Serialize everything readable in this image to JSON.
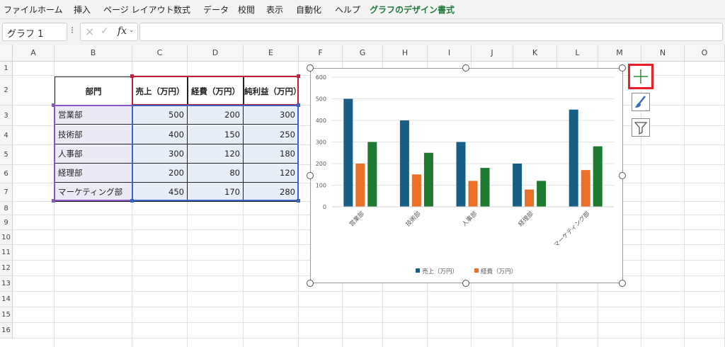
{
  "menu": [
    "ファイル",
    "ホーム",
    "挿入",
    "ページ レイアウト",
    "数式",
    "データ",
    "校閲",
    "表示",
    "自動化",
    "ヘルプ",
    "グラフのデザイン",
    "書式"
  ],
  "formula_bar": {
    "name_box": "グラフ 1",
    "fx": "fx",
    "value": ""
  },
  "columns": [
    "A",
    "B",
    "C",
    "D",
    "E",
    "F",
    "G",
    "H",
    "I",
    "J",
    "K",
    "L",
    "M",
    "N",
    "O"
  ],
  "rows": [
    "1",
    "2",
    "3",
    "4",
    "5",
    "6",
    "7",
    "8",
    "9",
    "10",
    "11",
    "12",
    "13",
    "14",
    "15",
    "16"
  ],
  "table": {
    "headers": [
      "部門",
      "売上（万円）",
      "経費（万円）",
      "純利益（万円）"
    ],
    "rows": [
      [
        "営業部",
        "500",
        "200",
        "300"
      ],
      [
        "技術部",
        "400",
        "150",
        "250"
      ],
      [
        "人事部",
        "300",
        "120",
        "180"
      ],
      [
        "経理部",
        "200",
        "80",
        "120"
      ],
      [
        "マーケティング部",
        "450",
        "170",
        "280"
      ]
    ]
  },
  "chart_data": {
    "type": "bar",
    "categories": [
      "営業部",
      "技術部",
      "人事部",
      "経理部",
      "マーケティング部"
    ],
    "series": [
      {
        "name": "売上（万円）",
        "values": [
          500,
          400,
          300,
          200,
          450
        ],
        "color": "#175f84"
      },
      {
        "name": "経費（万円）",
        "values": [
          200,
          150,
          120,
          80,
          170
        ],
        "color": "#e8702a"
      },
      {
        "name": "",
        "values": [
          300,
          250,
          180,
          120,
          280
        ],
        "color": "#1e7a30"
      }
    ],
    "ylim": [
      0,
      600
    ],
    "yticks": [
      "0",
      "100",
      "200",
      "300",
      "400",
      "500",
      "600"
    ],
    "grid": true,
    "legend": "bottom"
  },
  "chart_tools": [
    "plus-icon",
    "brush-icon",
    "filter-icon"
  ],
  "colors": {
    "accent_green": "#1e7a3a",
    "selection_red": "#e8202a"
  }
}
